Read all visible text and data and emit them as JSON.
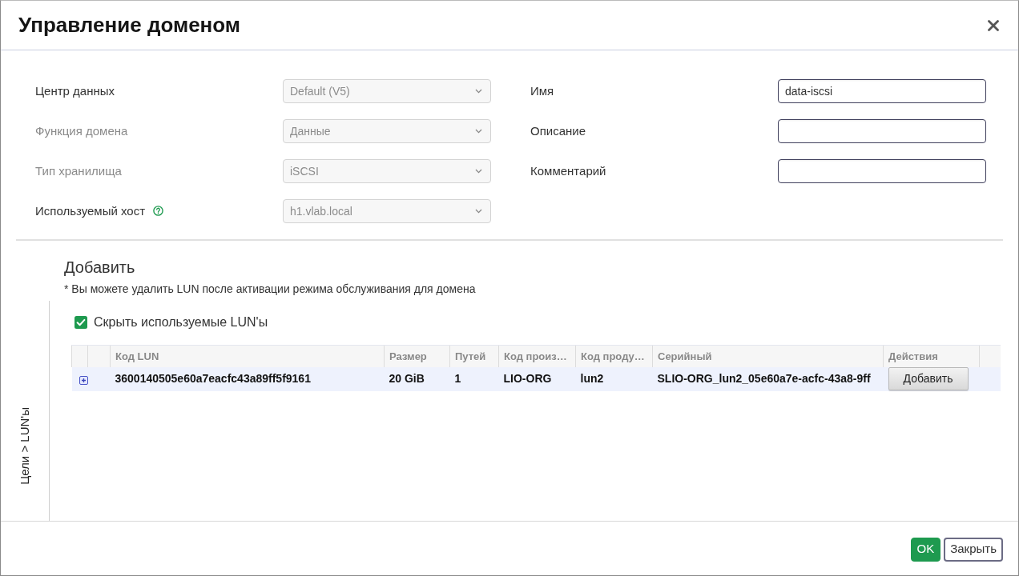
{
  "dialog": {
    "title": "Управление доменом"
  },
  "left_fields": [
    {
      "label": "Центр данных",
      "label_disabled": false,
      "value": "Default (V5)",
      "disabled": true,
      "help": false
    },
    {
      "label": "Функция домена",
      "label_disabled": true,
      "value": "Данные",
      "disabled": true,
      "help": false
    },
    {
      "label": "Тип хранилища",
      "label_disabled": true,
      "value": "iSCSI",
      "disabled": true,
      "help": false
    },
    {
      "label": "Используемый хост",
      "label_disabled": false,
      "value": "h1.vlab.local",
      "disabled": true,
      "help": true
    }
  ],
  "right_fields": [
    {
      "label": "Имя",
      "value": "data-iscsi"
    },
    {
      "label": "Описание"
    },
    {
      "label": "Комментарий"
    }
  ],
  "section": {
    "title": "Добавить",
    "note": "* Вы можете удалить LUN после активации режима обслуживания для домена"
  },
  "side_tab": {
    "label": "Цели > LUN'ы"
  },
  "hide_used": {
    "label": "Скрыть используемые LUN'ы",
    "checked": true
  },
  "table": {
    "columns": [
      "Код LUN",
      "Размер",
      "Путей",
      "Код произ…",
      "Код проду…",
      "Серийный",
      "Действия"
    ],
    "rows": [
      {
        "expanded": false,
        "selected": true,
        "cells": [
          "3600140505e60a7eacfc43a89ff5f9161",
          "20 GiB",
          "1",
          "LIO-ORG",
          "lun2",
          "SLIO-ORG_lun2_05e60a7e-acfc-43a8-9ff"
        ],
        "action": "Добавить"
      }
    ]
  },
  "buttons": [
    {
      "label": "OK",
      "kind": "primary"
    },
    {
      "label": "Закрыть",
      "kind": "secondary"
    }
  ]
}
